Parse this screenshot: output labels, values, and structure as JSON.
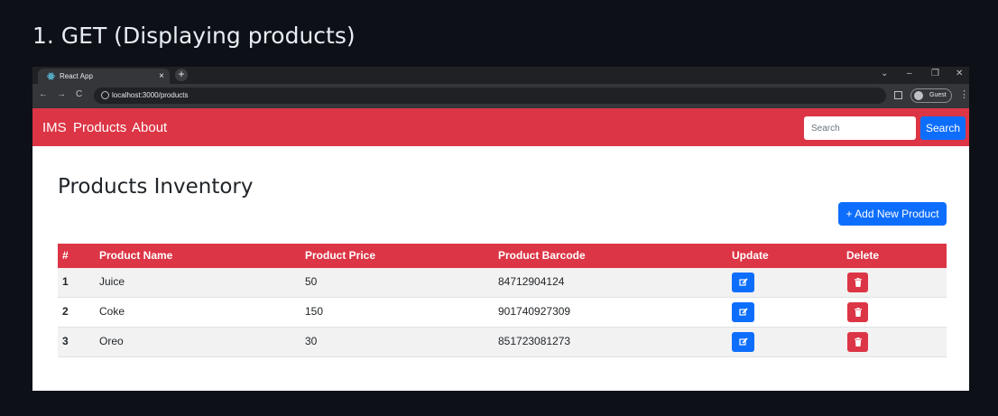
{
  "heading": "1. GET (Displaying products)",
  "browser": {
    "tab_title": "React App",
    "tab_close": "×",
    "new_tab": "+",
    "url": "localhost:3000/products",
    "profile": "Guest",
    "window_controls": [
      "⌄",
      "–",
      "❐",
      "✕"
    ],
    "nav_icons": [
      "←",
      "→",
      "C"
    ]
  },
  "navbar": {
    "brand": "IMS",
    "links": [
      "Products",
      "About"
    ],
    "search_placeholder": "Search",
    "search_button": "Search",
    "color": "#dc3545"
  },
  "page": {
    "title": "Products Inventory",
    "add_button": "+ Add New Product"
  },
  "table": {
    "columns": [
      "#",
      "Product Name",
      "Product Price",
      "Product Barcode",
      "Update",
      "Delete"
    ],
    "rows": [
      [
        "1",
        "Juice",
        "50",
        "84712904124"
      ],
      [
        "2",
        "Coke",
        "150",
        "901740927309"
      ],
      [
        "3",
        "Oreo",
        "30",
        "851723081273"
      ]
    ]
  },
  "colors": {
    "primary": "#0d6efd",
    "danger": "#dc3545",
    "stripe": "#f2f2f2"
  }
}
